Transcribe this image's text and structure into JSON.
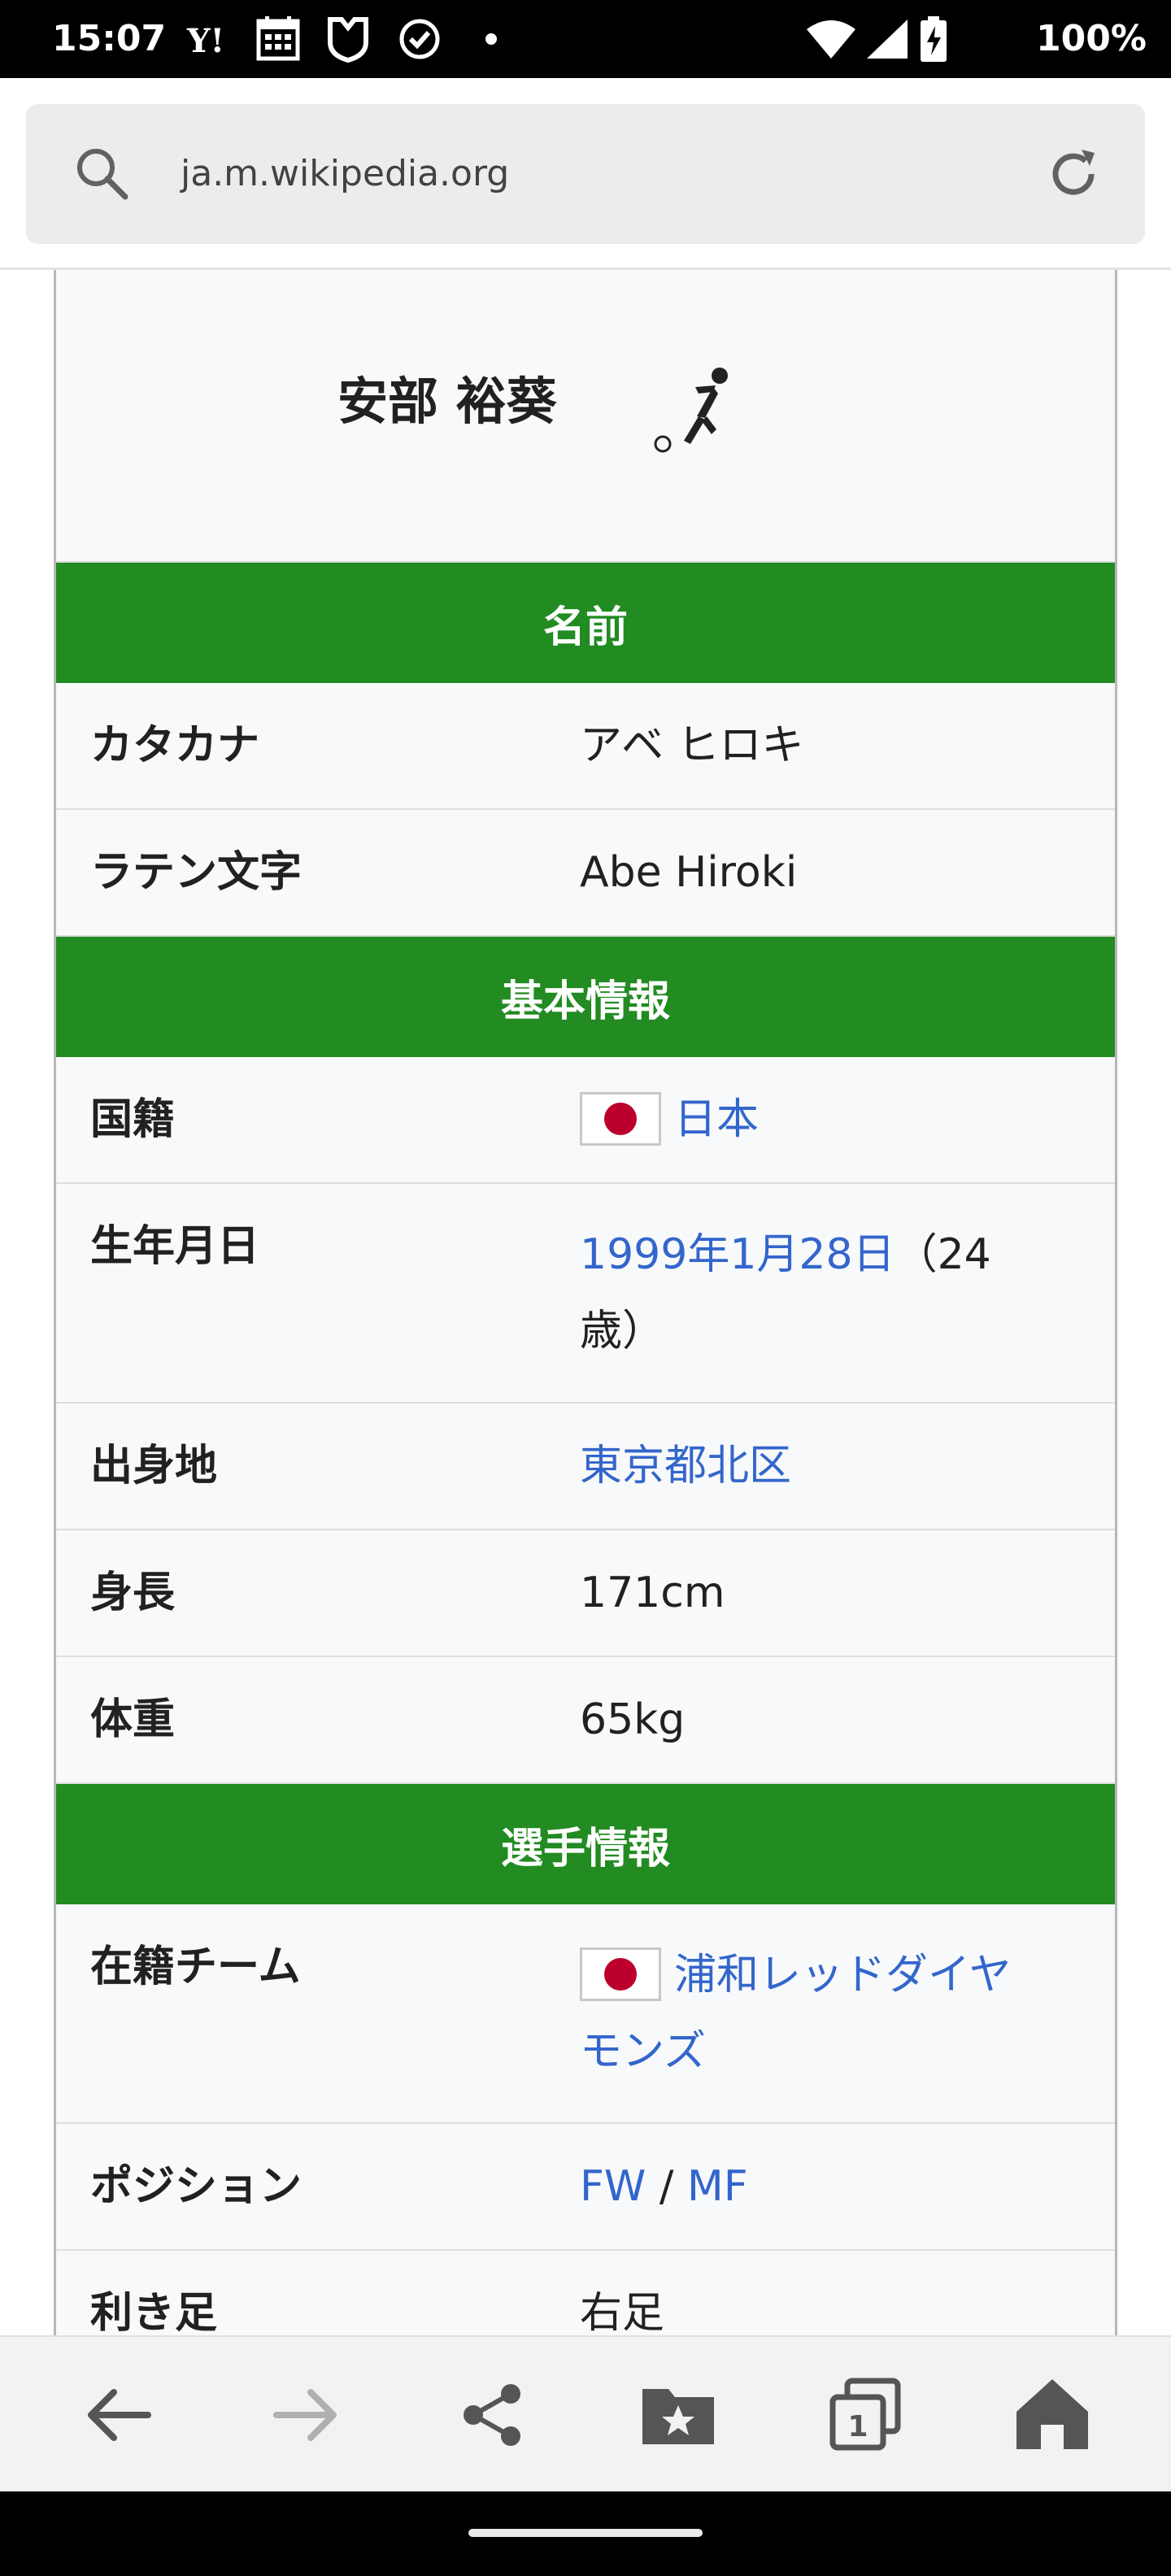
{
  "status_bar": {
    "time": "15:07",
    "battery": "100%",
    "icons": [
      "yahoo-icon",
      "calendar-icon",
      "shield-icon",
      "check-circle-icon",
      "dot-icon",
      "wifi-icon",
      "signal-icon",
      "battery-charging-icon"
    ]
  },
  "browser": {
    "url": "ja.m.wikipedia.org"
  },
  "infobox": {
    "name": "安部 裕葵",
    "sections": {
      "name": "名前",
      "basic": "基本情報",
      "player": "選手情報"
    },
    "rows": {
      "katakana": {
        "label": "カタカナ",
        "value": "アベ ヒロキ"
      },
      "latin": {
        "label": "ラテン文字",
        "value": "Abe Hiroki"
      },
      "nationality": {
        "label": "国籍",
        "value": "日本"
      },
      "birth": {
        "label": "生年月日",
        "date": "1999年1月28日",
        "age": "（24歳）"
      },
      "birthplace": {
        "label": "出身地",
        "value": "東京都北区"
      },
      "height": {
        "label": "身長",
        "value": "171cm"
      },
      "weight": {
        "label": "体重",
        "value": "65kg"
      },
      "team": {
        "label": "在籍チーム",
        "value": "浦和レッドダイヤモンズ"
      },
      "position": {
        "label": "ポジション",
        "fw": "FW",
        "sep": " / ",
        "mf": "MF"
      },
      "foot": {
        "label": "利き足",
        "value": "右足"
      }
    }
  },
  "colors": {
    "header_green": "#228b22",
    "link_blue": "#3366cc",
    "flag_red": "#bc002d"
  }
}
